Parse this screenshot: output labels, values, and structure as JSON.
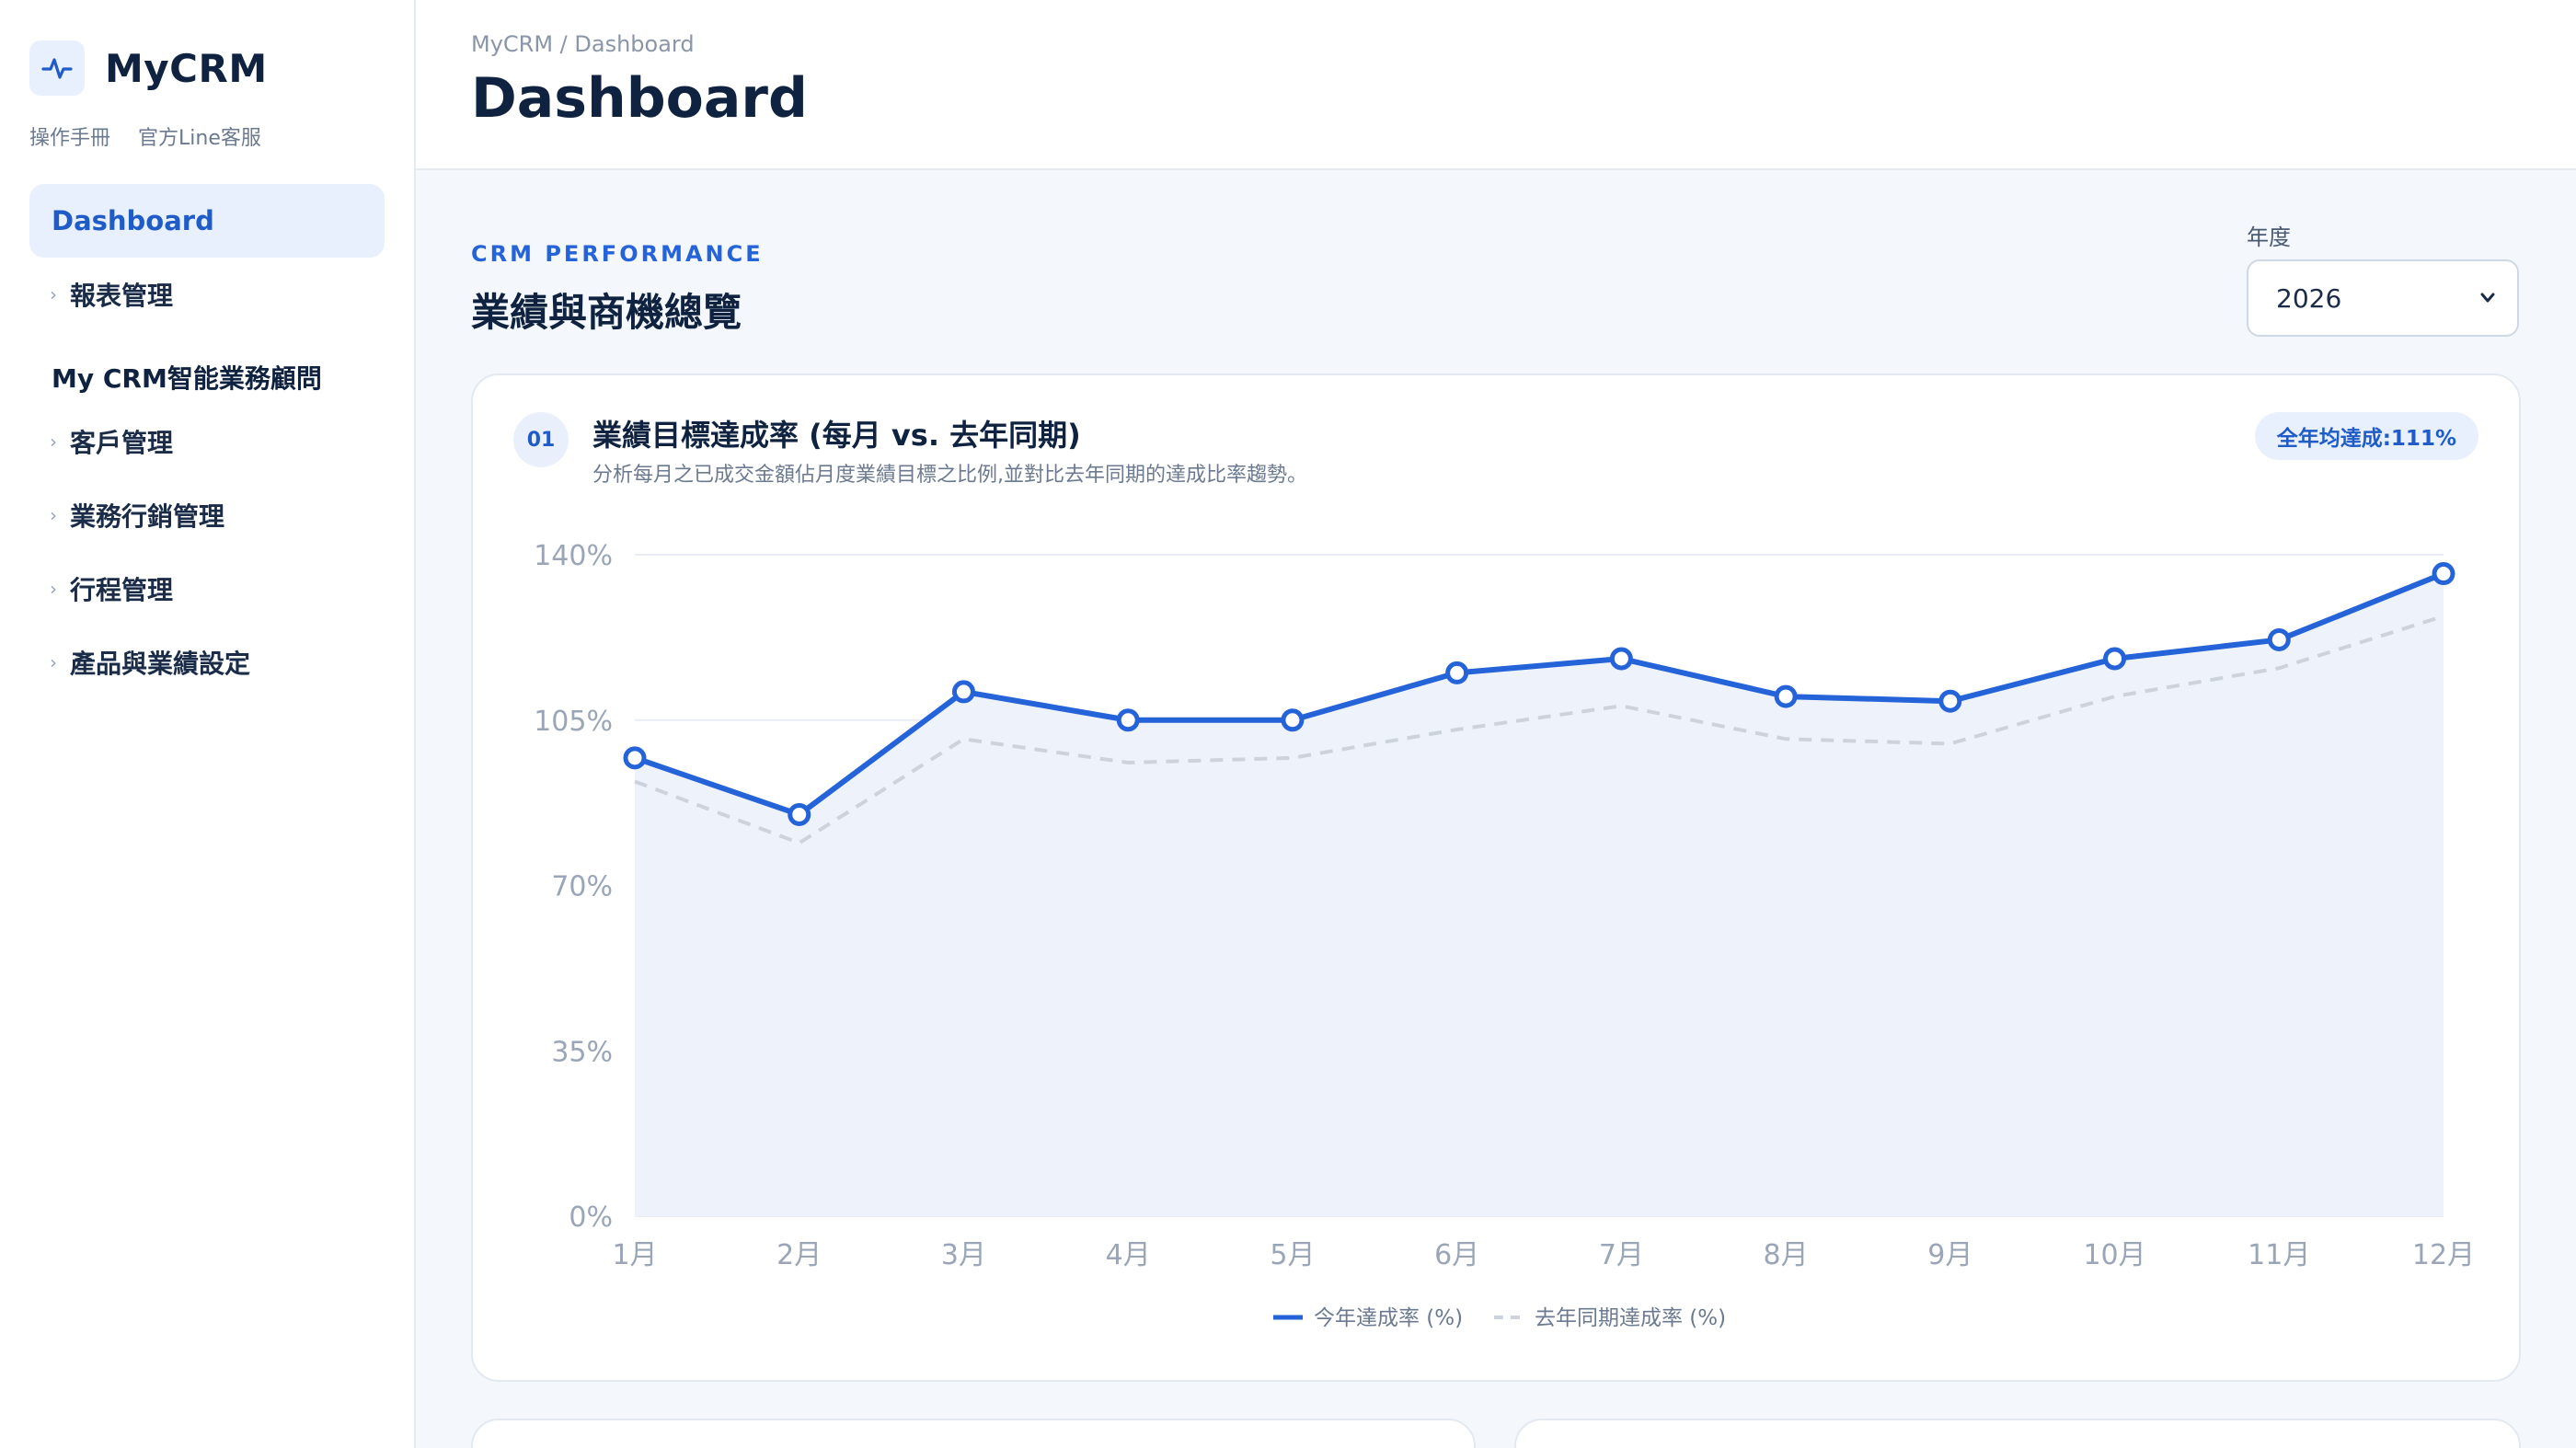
{
  "app": {
    "name": "MyCRM"
  },
  "sidebar": {
    "links": [
      "操作手冊",
      "官方Line客服"
    ],
    "active_item": "Dashboard",
    "items": [
      {
        "label": "報表管理"
      }
    ],
    "section_title": "My CRM智能業務顧問",
    "section_items": [
      {
        "label": "客戶管理"
      },
      {
        "label": "業務行銷管理"
      },
      {
        "label": "行程管理"
      },
      {
        "label": "產品與業績設定"
      }
    ]
  },
  "header": {
    "breadcrumb": "MyCRM / Dashboard",
    "title": "Dashboard"
  },
  "main": {
    "kicker": "CRM PERFORMANCE",
    "title": "業績與商機總覽",
    "year_label": "年度",
    "year_value": "2026"
  },
  "card": {
    "number": "01",
    "title": "業績目標達成率 (每月 vs. 去年同期)",
    "description": "分析每月之已成交金額佔月度業績目標之比例,並對比去年同期的達成比率趨勢。",
    "badge": "全年均達成:111%"
  },
  "colors": {
    "accent": "#2563d8",
    "previous_series": "#cdd3dd",
    "area_fill": "#eef2fb"
  },
  "chart_data": {
    "type": "line",
    "categories": [
      "1月",
      "2月",
      "3月",
      "4月",
      "5月",
      "6月",
      "7月",
      "8月",
      "9月",
      "10月",
      "11月",
      "12月"
    ],
    "series": [
      {
        "name": "今年達成率 (%)",
        "values": [
          97,
          85,
          111,
          105,
          105,
          115,
          118,
          110,
          109,
          118,
          122,
          136
        ]
      },
      {
        "name": "去年同期達成率 (%)",
        "values": [
          92,
          79,
          101,
          96,
          97,
          103,
          108,
          101,
          100,
          110,
          116,
          127
        ]
      }
    ],
    "y_ticks": [
      "0%",
      "35%",
      "70%",
      "105%",
      "140%"
    ],
    "ylim": [
      0,
      140
    ],
    "grid": true,
    "legend_position": "bottom-center"
  }
}
